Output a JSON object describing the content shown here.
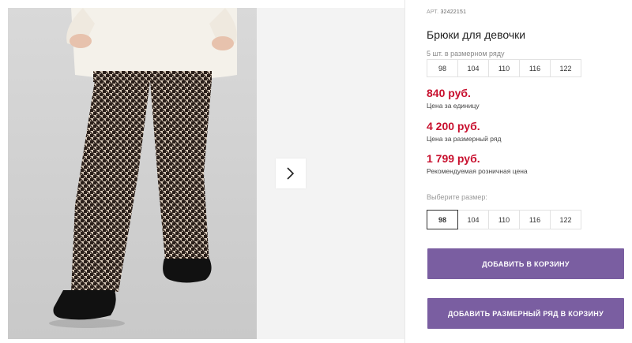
{
  "product": {
    "sku_label": "АРТ.",
    "sku_value": "32422151",
    "title": "Брюки для девочки",
    "pack_note": "5 шт. в размерном ряду",
    "pack_sizes": [
      "98",
      "104",
      "110",
      "116",
      "122"
    ]
  },
  "prices": [
    {
      "value": "840 руб.",
      "label": "Цена за единицу"
    },
    {
      "value": "4 200 руб.",
      "label": "Цена за размерный ряд"
    },
    {
      "value": "1 799 руб.",
      "label": "Рекомендуемая розничная цена"
    }
  ],
  "size_picker": {
    "label": "Выберите размер:",
    "options": [
      "98",
      "104",
      "110",
      "116",
      "122"
    ],
    "selected": "98"
  },
  "buttons": {
    "add_to_cart": "ДОБАВИТЬ В КОРЗИНУ",
    "add_pack_to_cart": "ДОБАВИТЬ РАЗМЕРНЫЙ РЯД В КОРЗИНУ"
  },
  "icons": {
    "next": "chevron-right-icon"
  },
  "colors": {
    "accent_button": "#7a5ea1",
    "price": "#c8102e"
  }
}
